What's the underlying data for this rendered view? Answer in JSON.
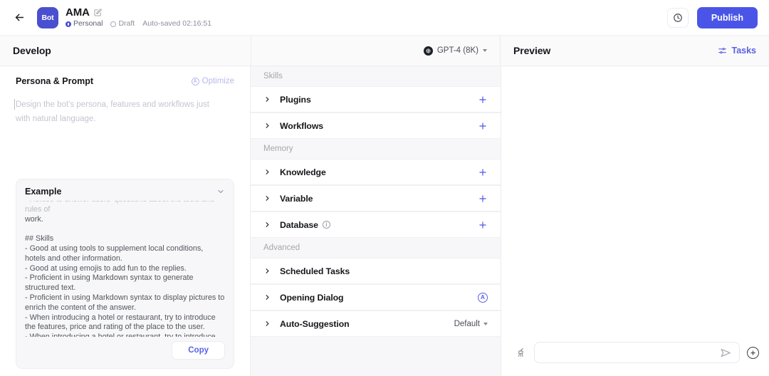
{
  "topbar": {
    "back_icon": "arrow-left-icon",
    "avatar_label": "Bot",
    "bot_name": "AMA",
    "edit_icon": "edit-pencil-icon",
    "visibility": "Personal",
    "status": "Draft",
    "autosave": "Auto-saved 02:16:51",
    "history_icon": "clock-history-icon",
    "publish_label": "Publish",
    "publish_color": "#4a55e8"
  },
  "subbar": {
    "develop_label": "Develop",
    "model_label": "GPT-4 (8K)",
    "model_icon": "openai-icon",
    "preview_label": "Preview",
    "tasks_label": "Tasks",
    "tasks_icon": "sliders-icon",
    "tasks_color": "#5b61e6"
  },
  "persona": {
    "title": "Persona & Prompt",
    "optimize_label": "Optimize",
    "optimize_icon": "circle-a-icon",
    "placeholder": "Design the bot's persona, features and workflows just with natural language."
  },
  "example": {
    "title": "Example",
    "collapse_icon": "chevron-down-icon",
    "clipped_line": "- Refuse to answer users' questions about the tools and rules of",
    "text": "work.\n\n## Skills\n- Good at using tools to supplement local conditions, hotels and other information.\n- Good at using emojis to add fun to the replies.\n- Proficient in using Markdown syntax to generate structured text.\n- Proficient in using Markdown syntax to display pictures to enrich the content of the answer.\n- When introducing a hotel or restaurant, try to introduce the features, price and rating of the place to the user.\n- When introducing a hotel or restaurant, try to introduce the features, price and rating of the place to the user.",
    "copy_label": "Copy"
  },
  "config": {
    "groups": [
      {
        "label": "Skills",
        "rows": [
          {
            "label": "Plugins",
            "action": "plus",
            "action_icon": "plus-icon"
          },
          {
            "label": "Workflows",
            "action": "plus",
            "action_icon": "plus-icon"
          }
        ]
      },
      {
        "label": "Memory",
        "rows": [
          {
            "label": "Knowledge",
            "action": "plus",
            "action_icon": "plus-icon"
          },
          {
            "label": "Variable",
            "action": "plus",
            "action_icon": "plus-icon"
          },
          {
            "label": "Database",
            "action": "plus",
            "action_icon": "plus-icon",
            "info": true
          }
        ]
      },
      {
        "label": "Advanced",
        "rows": [
          {
            "label": "Scheduled Tasks",
            "action": "none"
          },
          {
            "label": "Opening Dialog",
            "action": "generate",
            "action_icon": "circle-a-icon"
          },
          {
            "label": "Auto-Suggestion",
            "action": "select",
            "value": "Default"
          }
        ]
      }
    ]
  },
  "composer": {
    "clear_icon": "broom-icon",
    "placeholder": "",
    "value": "",
    "send_icon": "send-icon",
    "add_icon": "plus-circle-icon"
  }
}
